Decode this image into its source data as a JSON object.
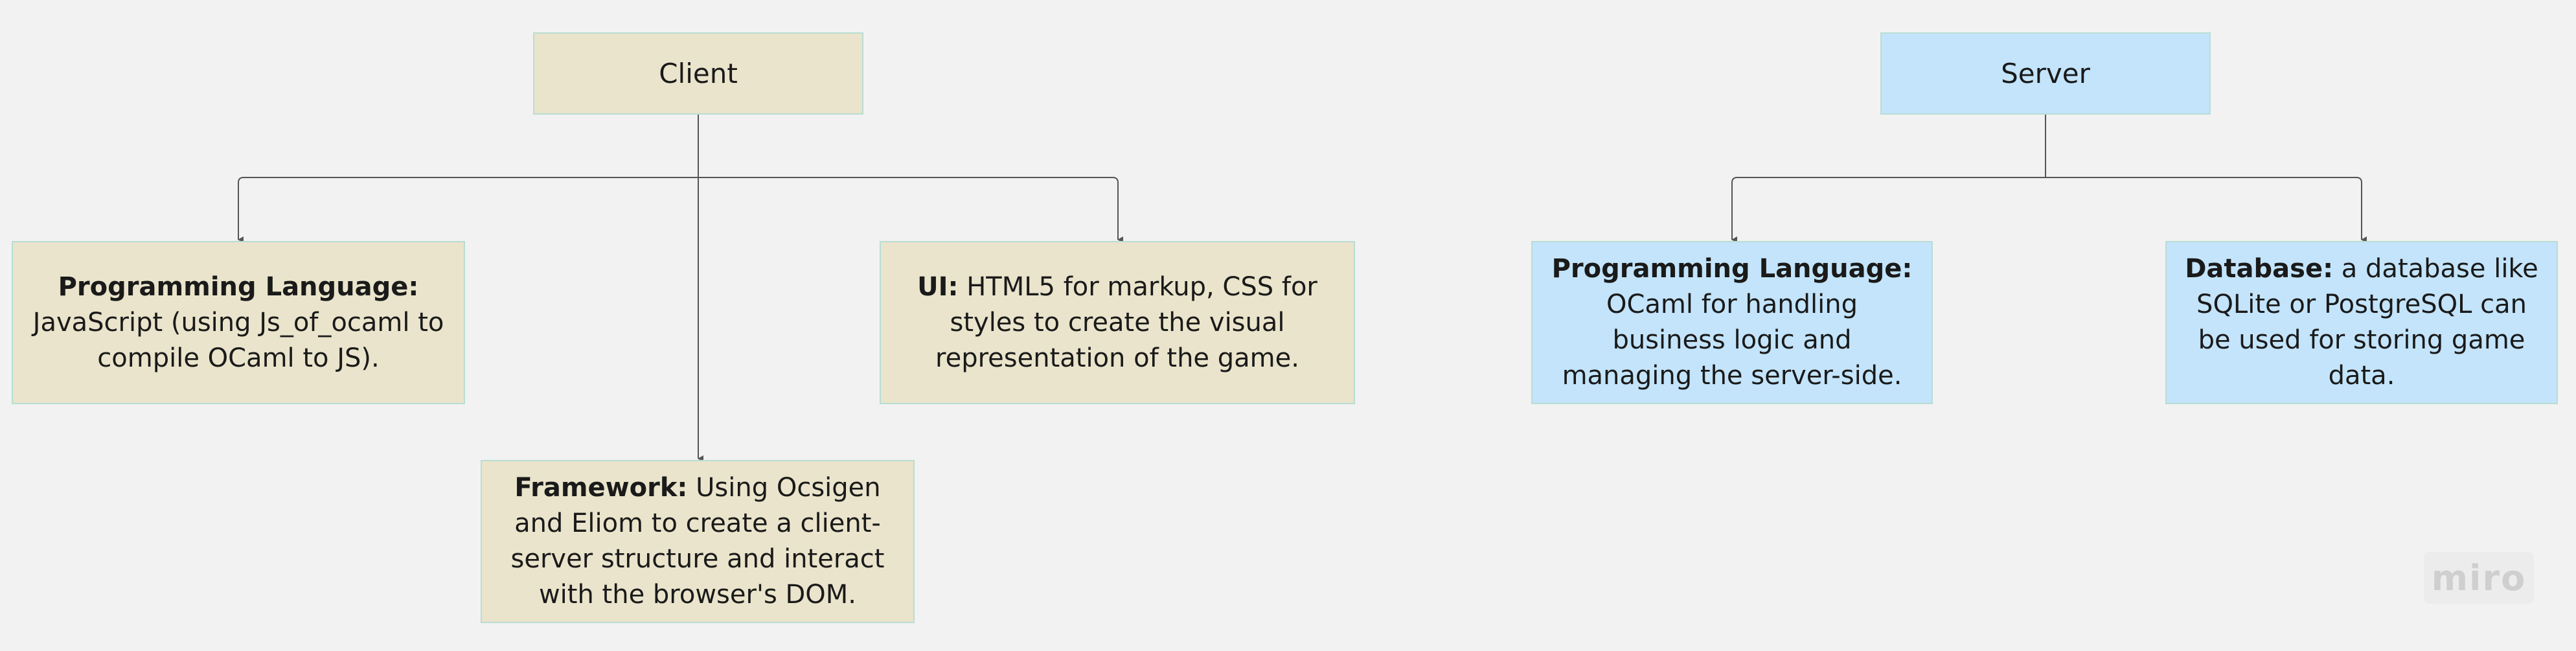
{
  "nodes": {
    "client": {
      "title": "Client"
    },
    "server": {
      "title": "Server"
    },
    "client_programming_language": {
      "label": "Programming Language:",
      "text": " JavaScript (using Js_of_ocaml to compile OCaml to JS)."
    },
    "client_ui": {
      "label": "UI:",
      "text": " HTML5 for markup, CSS for styles to create the visual representation of the game."
    },
    "client_framework": {
      "label": "Framework:",
      "text": " Using Ocsigen and Eliom to create a client-server structure and interact with the browser's DOM."
    },
    "server_programming_language": {
      "label": "Programming Language:",
      "text": " OCaml for handling business logic and managing the server-side."
    },
    "server_database": {
      "label": "Database:",
      "text": " a database like SQLite or PostgreSQL can be used for storing game data."
    }
  },
  "edges": [
    {
      "from": "Client",
      "to": "Programming Language"
    },
    {
      "from": "Client",
      "to": "UI"
    },
    {
      "from": "Client",
      "to": "Framework"
    },
    {
      "from": "Server",
      "to": "Programming Language"
    },
    {
      "from": "Server",
      "to": "Database"
    }
  ],
  "colors": {
    "client_fill": "#e9e4cb",
    "server_fill": "#c3e4fb",
    "border": "#b9ddd3",
    "connector": "#555555",
    "background": "#f2f2f2"
  },
  "watermark": "miro"
}
